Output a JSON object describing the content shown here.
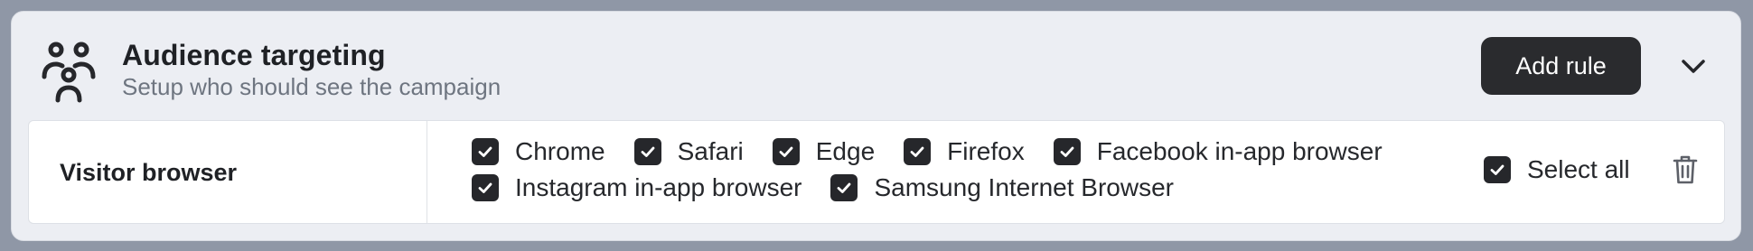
{
  "header": {
    "icon": "audience-icon",
    "title": "Audience targeting",
    "subtitle": "Setup who should see the campaign",
    "add_rule_label": "Add rule",
    "collapse_icon": "chevron-down-icon"
  },
  "rule": {
    "label": "Visitor browser",
    "options": [
      {
        "label": "Chrome",
        "checked": true
      },
      {
        "label": "Safari",
        "checked": true
      },
      {
        "label": "Edge",
        "checked": true
      },
      {
        "label": "Firefox",
        "checked": true
      },
      {
        "label": "Facebook in-app browser",
        "checked": true
      },
      {
        "label": "Instagram in-app browser",
        "checked": true
      },
      {
        "label": "Samsung Internet Browser",
        "checked": true
      }
    ],
    "select_all": {
      "label": "Select all",
      "checked": true
    },
    "delete_icon": "trash-icon"
  },
  "colors": {
    "accent_dark": "#26272b",
    "card_bg": "#eceef3",
    "page_bg": "#8f97a6"
  }
}
